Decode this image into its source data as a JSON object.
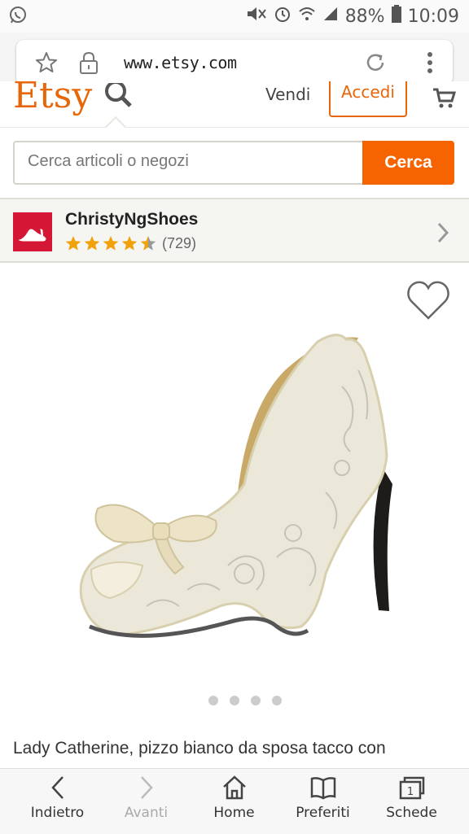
{
  "status": {
    "battery": "88%",
    "time": "10:09"
  },
  "browser": {
    "url": "www.etsy.com"
  },
  "header": {
    "logo": "Etsy",
    "sell": "Vendi",
    "signin": "Accedi"
  },
  "search": {
    "placeholder": "Cerca articoli o negozi",
    "button": "Cerca"
  },
  "shop": {
    "name": "ChristyNgShoes",
    "reviews": "(729)",
    "rating": 4.5
  },
  "product": {
    "title": "Lady Catherine, pizzo bianco da sposa tacco con",
    "image_count": 4
  },
  "nav": {
    "back": "Indietro",
    "forward": "Avanti",
    "home": "Home",
    "bookmarks": "Preferiti",
    "tabs": "Schede",
    "tabs_count": "1"
  },
  "colors": {
    "brand": "#f56400",
    "shop_logo": "#d31735",
    "star": "#f1a10a"
  }
}
